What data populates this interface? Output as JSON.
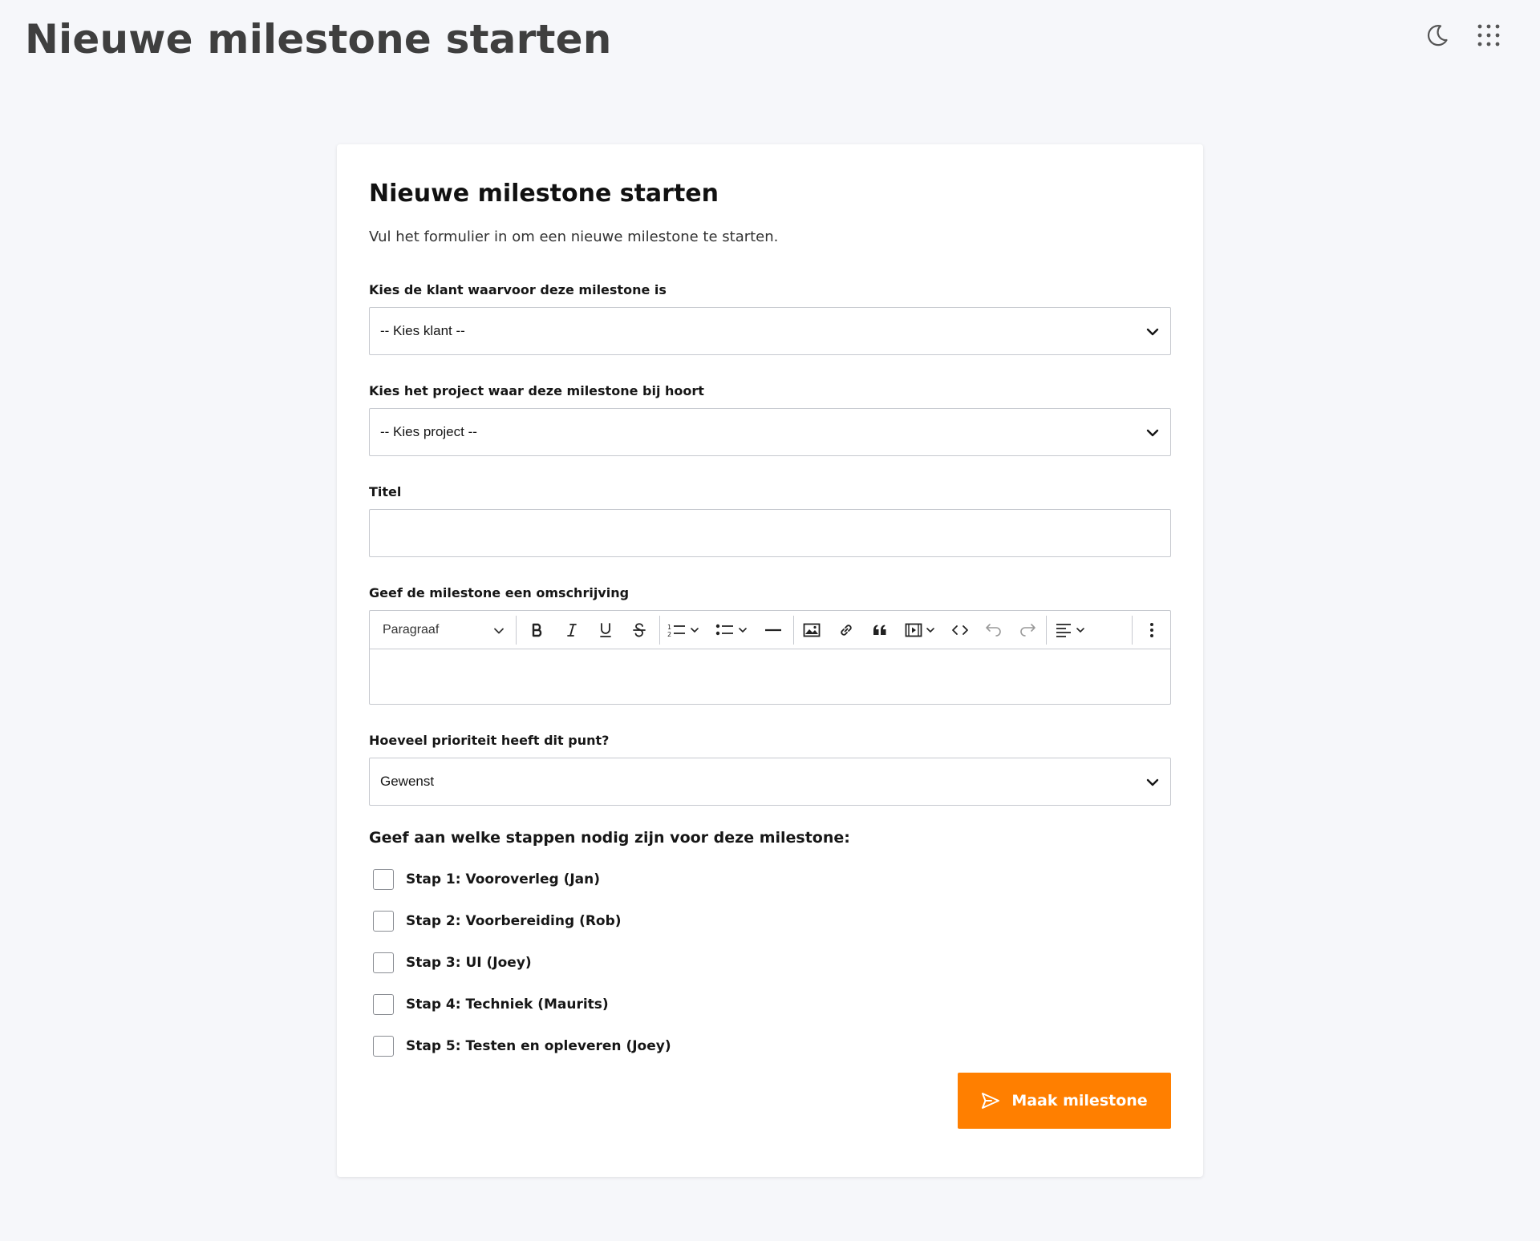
{
  "header": {
    "title": "Nieuwe milestone starten"
  },
  "card": {
    "title": "Nieuwe milestone starten",
    "subtitle": "Vul het formulier in om een nieuwe milestone te starten."
  },
  "form": {
    "client": {
      "label": "Kies de klant waarvoor deze milestone is",
      "selected": "-- Kies klant --"
    },
    "project": {
      "label": "Kies het project waar deze milestone bij hoort",
      "selected": "-- Kies project --"
    },
    "title": {
      "label": "Titel",
      "value": ""
    },
    "description": {
      "label": "Geef de milestone een omschrijving",
      "paragraph_style": "Paragraaf",
      "value": ""
    },
    "priority": {
      "label": "Hoeveel prioriteit heeft dit punt?",
      "selected": "Gewenst"
    },
    "steps": {
      "title": "Geef aan welke stappen nodig zijn voor deze milestone:",
      "items": [
        {
          "label": "Stap 1: Vooroverleg (Jan)",
          "checked": false
        },
        {
          "label": "Stap 2: Voorbereiding (Rob)",
          "checked": false
        },
        {
          "label": "Stap 3: UI (Joey)",
          "checked": false
        },
        {
          "label": "Stap 4: Techniek (Maurits)",
          "checked": false
        },
        {
          "label": "Stap 5: Testen en opleveren (Joey)",
          "checked": false
        }
      ]
    },
    "submit_label": "Maak milestone"
  },
  "icons": {
    "dark_mode": "moon-icon",
    "apps": "grid-dots-icon",
    "submit": "send-icon"
  },
  "colors": {
    "accent": "#ff7f00",
    "background": "#f6f7fa",
    "border": "#c6c9cf"
  }
}
